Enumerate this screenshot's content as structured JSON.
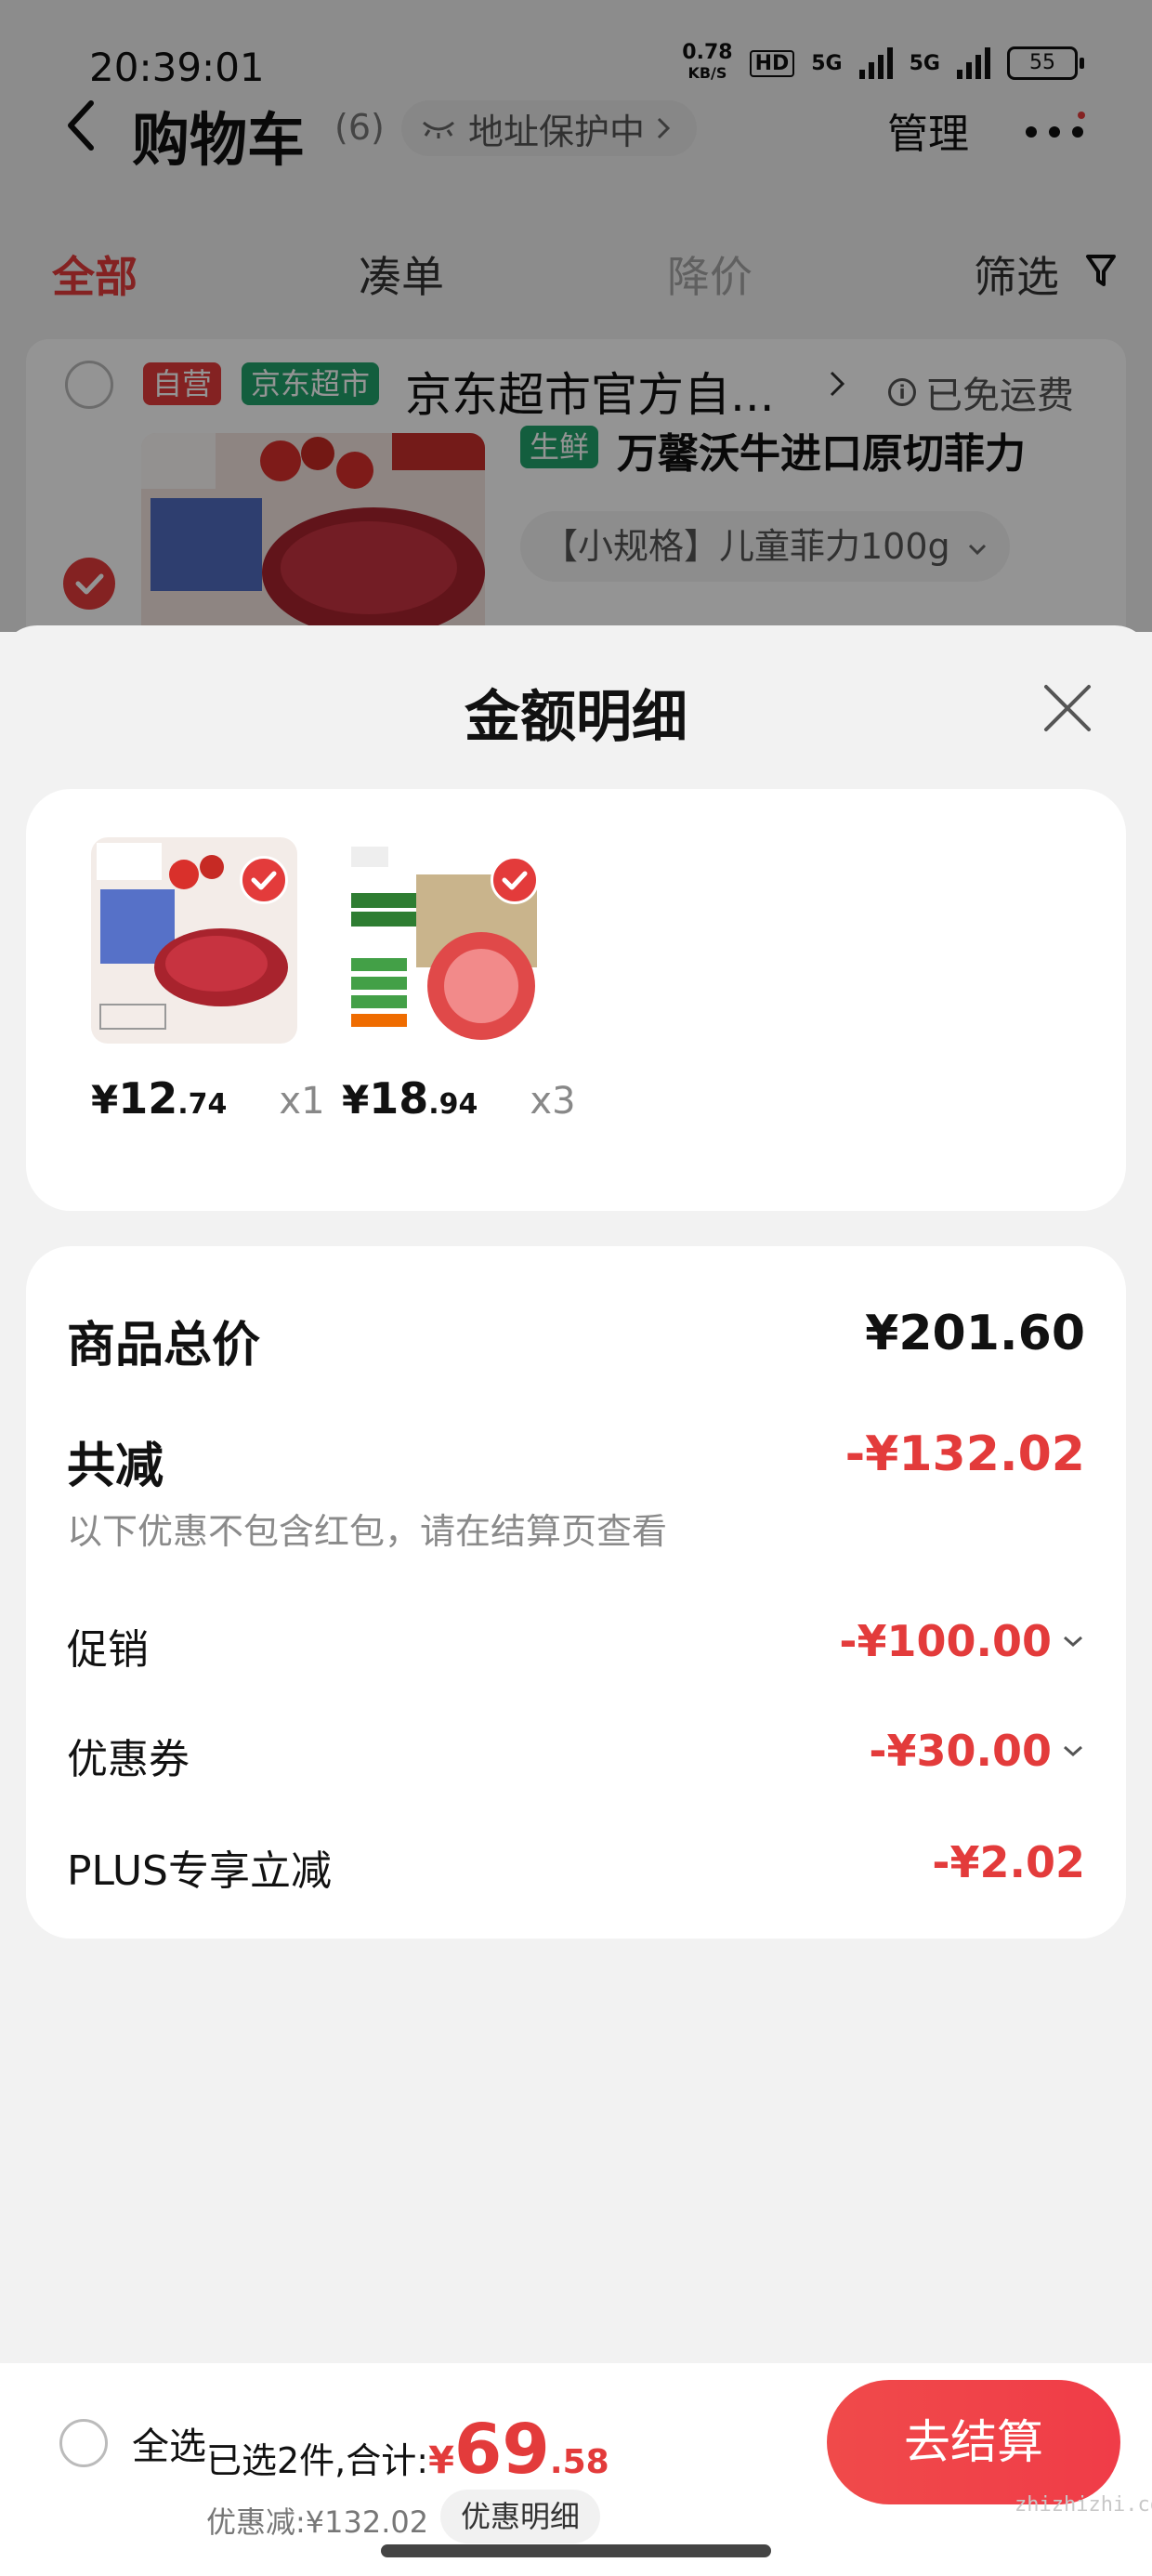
{
  "status_bar": {
    "time": "20:39:01",
    "speed_value": "0.78",
    "speed_unit": "KB/S",
    "hd": "HD",
    "signal_1": "5G",
    "signal_2": "5G",
    "battery": "55"
  },
  "header": {
    "title": "购物车",
    "count": "(6)",
    "address_protect": "地址保护中",
    "manage": "管理"
  },
  "tabs": [
    {
      "label": "全部"
    },
    {
      "label": "凑单"
    },
    {
      "label": "降价"
    },
    {
      "label": "筛选"
    }
  ],
  "shop": {
    "tag_self": "自营",
    "tag_market": "京东超市",
    "name": "京东超市官方自...",
    "free_shipping": "已免运费"
  },
  "product": {
    "fresh_tag": "生鲜",
    "name": "万馨沃牛进口原切菲力",
    "spec": "【小规格】儿童菲力100g"
  },
  "sheet": {
    "title": "金额明细",
    "items": [
      {
        "yen": "¥",
        "price_int": "12",
        "price_dec": ".74",
        "qty": "x1"
      },
      {
        "yen": "¥",
        "price_int": "18",
        "price_dec": ".94",
        "qty": "x3"
      }
    ],
    "summary": {
      "total_label": "商品总价",
      "total_value": "¥201.60",
      "reduce_label": "共减",
      "reduce_value": "-¥132.02",
      "note": "以下优惠不包含红包，请在结算页查看",
      "promo_label": "促销",
      "promo_value": "-¥100.00",
      "coupon_label": "优惠券",
      "coupon_value": "-¥30.00",
      "plus_label": "PLUS专享立减",
      "plus_value": "-¥2.02"
    }
  },
  "bottom_bar": {
    "select_all": "全选",
    "selected_text": "已选2件,合计:",
    "total_yen": "¥",
    "total_int": "69",
    "total_dec": ".58",
    "discount_text": "优惠减:¥132.02",
    "detail_button": "优惠明细",
    "checkout": "去结算",
    "watermark": "zhizhizhi.com"
  },
  "colors": {
    "accent": "#e33b3b",
    "green_tag": "#21a36c",
    "page_bg": "#f2f2f2"
  }
}
